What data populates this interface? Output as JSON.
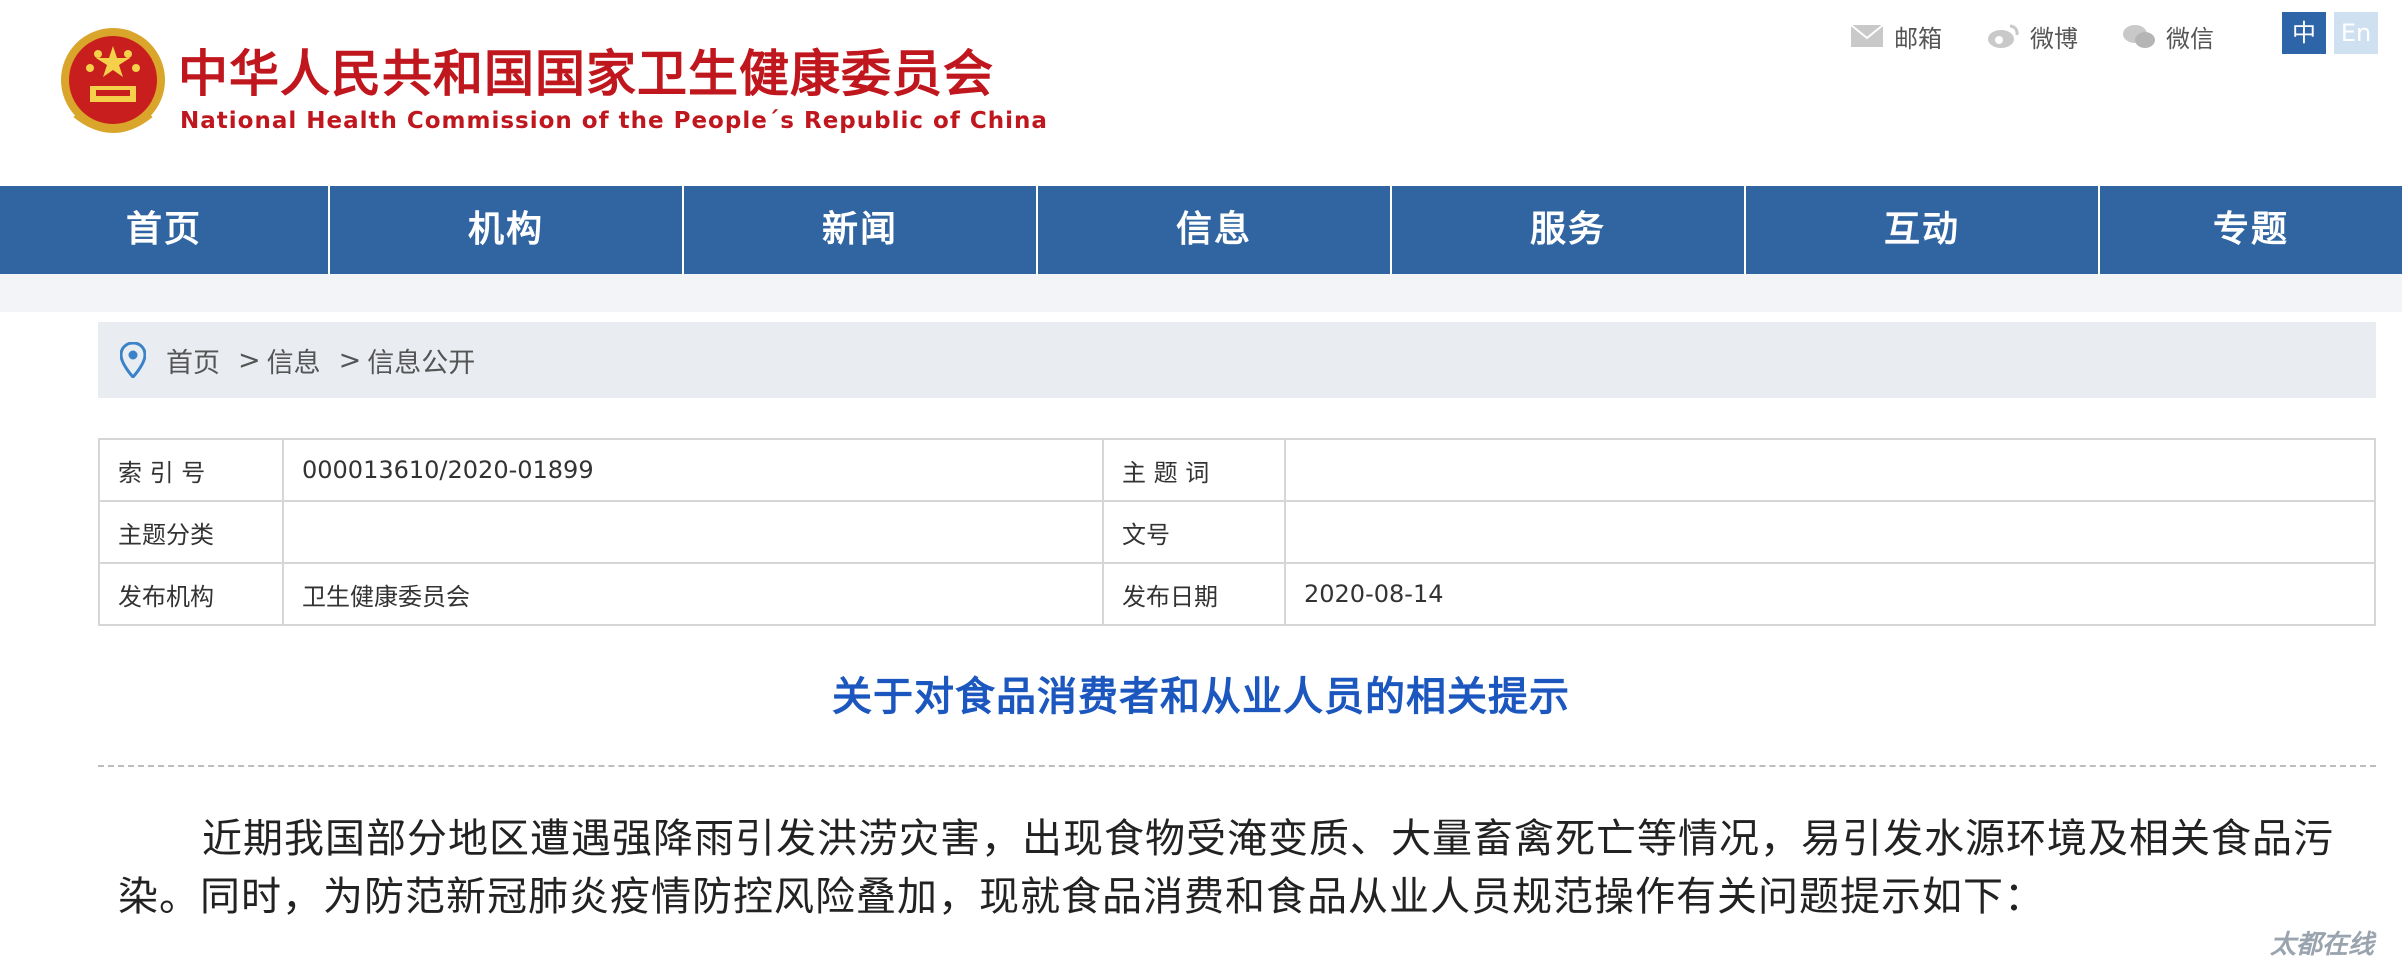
{
  "header": {
    "title_cn": "中华人民共和国国家卫生健康委员会",
    "title_en": "National Health Commission of the People´s Republic of China",
    "links": [
      {
        "label": "邮箱",
        "icon": "mail-icon"
      },
      {
        "label": "微博",
        "icon": "weibo-icon"
      },
      {
        "label": "微信",
        "icon": "wechat-icon"
      }
    ],
    "lang_zh": "中",
    "lang_en": "En"
  },
  "nav": {
    "items": [
      {
        "label": "首页"
      },
      {
        "label": "机构"
      },
      {
        "label": "新闻"
      },
      {
        "label": "信息"
      },
      {
        "label": "服务"
      },
      {
        "label": "互动"
      },
      {
        "label": "专题"
      }
    ]
  },
  "breadcrumb": {
    "items": [
      "首页",
      "信息",
      "信息公开"
    ],
    "separator": ">"
  },
  "meta": {
    "rows": [
      {
        "k1": "索 引 号",
        "v1": "000013610/2020-01899",
        "k2": "主 题 词",
        "v2": ""
      },
      {
        "k1": "主题分类",
        "v1": "",
        "k2": "文号",
        "v2": ""
      },
      {
        "k1": "发布机构",
        "v1": "卫生健康委员会",
        "k2": "发布日期",
        "v2": "2020-08-14"
      }
    ]
  },
  "article": {
    "title": "关于对食品消费者和从业人员的相关提示",
    "paragraph": "近期我国部分地区遭遇强降雨引发洪涝灾害，出现食物受淹变质、大量畜禽死亡等情况，易引发水源环境及相关食品污染。同时，为防范新冠肺炎疫情防控风险叠加，现就食品消费和食品从业人员规范操作有关问题提示如下："
  },
  "watermark": "太都在线",
  "colors": {
    "brand_red": "#c0171e",
    "nav_blue": "#3165a2",
    "title_blue": "#1c57bf"
  }
}
